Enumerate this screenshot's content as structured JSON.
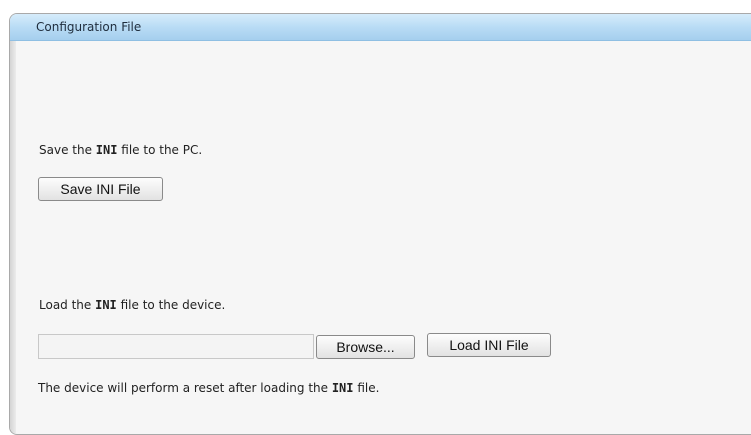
{
  "panel": {
    "title": "Configuration File"
  },
  "save_section": {
    "text_before": "Save the ",
    "text_bold": "INI",
    "text_after": " file to the PC.",
    "button_label": "Save INI File"
  },
  "load_section": {
    "text_before": "Load the ",
    "text_bold": "INI",
    "text_after": " file to the device.",
    "file_input_value": "",
    "browse_label": "Browse...",
    "load_button_label": "Load INI File"
  },
  "note": {
    "text_before": "The device will perform a reset after loading the ",
    "text_bold": "INI",
    "text_after": " file."
  }
}
